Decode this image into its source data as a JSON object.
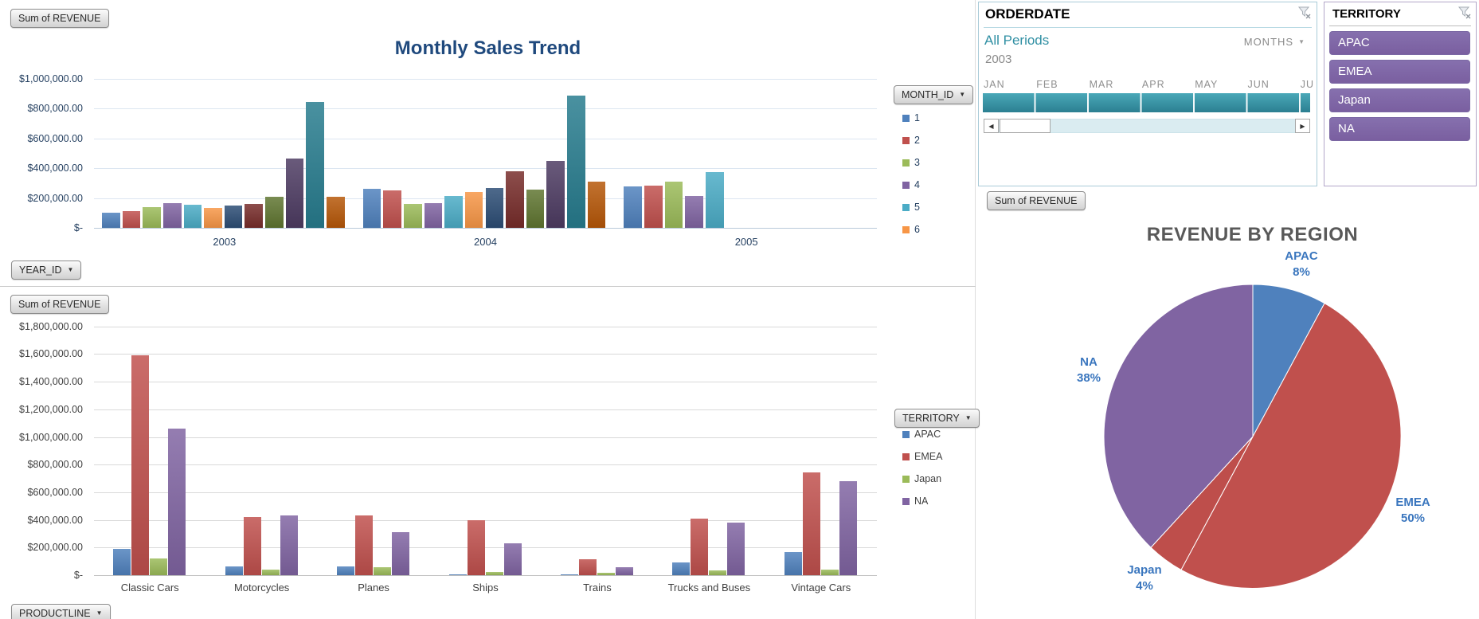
{
  "top_chart": {
    "field_button": "Sum of REVENUE",
    "axis_button": "YEAR_ID",
    "legend_button": "MONTH_ID",
    "title": "Monthly Sales Trend",
    "chart_data": {
      "type": "bar",
      "title": "Monthly Sales Trend",
      "ylabel": "Sum of REVENUE",
      "ylim": [
        0,
        1000000
      ],
      "grid": true,
      "legend_position": "right",
      "yticks": [
        "$1,000,000.00",
        "$800,000.00",
        "$600,000.00",
        "$400,000.00",
        "$200,000.00",
        "$-"
      ],
      "legend": {
        "title": "MONTH_ID",
        "items": [
          "1",
          "2",
          "3",
          "4",
          "5",
          "6"
        ]
      },
      "series_colors": [
        "#4F81BD",
        "#C0504D",
        "#9BBB59",
        "#8064A2",
        "#4BACC6",
        "#F79646",
        "#2C4D75",
        "#772C2A",
        "#5F7530",
        "#4D3B62",
        "#277C8E",
        "#B65708"
      ],
      "groups": [
        {
          "label": "2003",
          "values": [
            100000,
            112000,
            138000,
            165000,
            155000,
            133000,
            148000,
            160000,
            207000,
            462000,
            845000,
            207000
          ]
        },
        {
          "label": "2004",
          "values": [
            260000,
            250000,
            160000,
            165000,
            213000,
            239000,
            266000,
            378000,
            255000,
            447000,
            888000,
            308000
          ]
        },
        {
          "label": "2005",
          "values": [
            277000,
            282000,
            308000,
            213000,
            372000
          ]
        }
      ]
    }
  },
  "bottom_chart": {
    "field_button": "Sum of REVENUE",
    "axis_button": "PRODUCTLINE",
    "legend_button": "TERRITORY",
    "chart_data": {
      "type": "bar",
      "ylabel": "Sum of REVENUE",
      "ylim": [
        0,
        1800000
      ],
      "grid": true,
      "legend_position": "right",
      "yticks": [
        "$1,800,000.00",
        "$1,600,000.00",
        "$1,400,000.00",
        "$1,200,000.00",
        "$1,000,000.00",
        "$800,000.00",
        "$600,000.00",
        "$400,000.00",
        "$200,000.00",
        "$-"
      ],
      "categories": [
        "Classic Cars",
        "Motorcycles",
        "Planes",
        "Ships",
        "Trains",
        "Trucks and Buses",
        "Vintage Cars"
      ],
      "series": [
        {
          "name": "APAC",
          "color": "#4F81BD",
          "values": [
            190000,
            65000,
            65000,
            8000,
            8000,
            95000,
            168000
          ]
        },
        {
          "name": "EMEA",
          "color": "#C0504D",
          "values": [
            1590000,
            420000,
            430000,
            398000,
            113000,
            409000,
            743000
          ]
        },
        {
          "name": "Japan",
          "color": "#9BBB59",
          "values": [
            120000,
            38000,
            55000,
            25000,
            15000,
            36000,
            42000
          ]
        },
        {
          "name": "NA",
          "color": "#8064A2",
          "values": [
            1060000,
            430000,
            310000,
            230000,
            57000,
            380000,
            680000
          ]
        }
      ]
    }
  },
  "orderdate_slicer": {
    "title": "ORDERDATE",
    "selection_label": "All Periods",
    "level_label": "MONTHS",
    "year_label": "2003",
    "months": [
      "JAN",
      "FEB",
      "MAR",
      "APR",
      "MAY",
      "JUN",
      "JU"
    ]
  },
  "territory_slicer": {
    "title": "TERRITORY",
    "items": [
      "APAC",
      "EMEA",
      "Japan",
      "NA"
    ]
  },
  "pie_section": {
    "field_button": "Sum of REVENUE",
    "title": "REVENUE BY REGION",
    "chart_data": {
      "type": "pie",
      "title": "REVENUE BY REGION",
      "labels": [
        "APAC",
        "EMEA",
        "Japan",
        "NA"
      ],
      "values_pct": [
        8,
        50,
        4,
        38
      ],
      "pct_labels": [
        "8%",
        "50%",
        "4%",
        "38%"
      ],
      "colors": [
        "#4F81BD",
        "#C0504D",
        "#BE4E4B",
        "#8064A2"
      ],
      "label_color": "#3A76BE",
      "start_angle": "top",
      "direction": "clockwise"
    }
  }
}
